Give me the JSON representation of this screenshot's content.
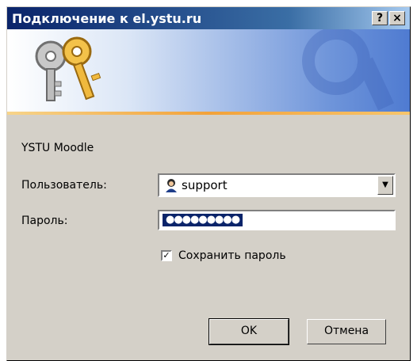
{
  "title": "Подключение к el.ystu.ru",
  "title_buttons": {
    "help": "?",
    "close": "×"
  },
  "site_label": "YSTU Moodle",
  "user": {
    "label": "Пользователь:",
    "value": "support",
    "icon": "user-icon"
  },
  "password": {
    "label": "Пароль:",
    "masked_value": "●●●●●●●●●"
  },
  "remember": {
    "label": "Сохранить пароль",
    "checked": true
  },
  "buttons": {
    "ok": "OK",
    "cancel": "Отмена"
  },
  "colors": {
    "title_bar": "#0a246a",
    "dialog_bg": "#d4d0c8",
    "banner_stripe": "#f2a23a"
  }
}
